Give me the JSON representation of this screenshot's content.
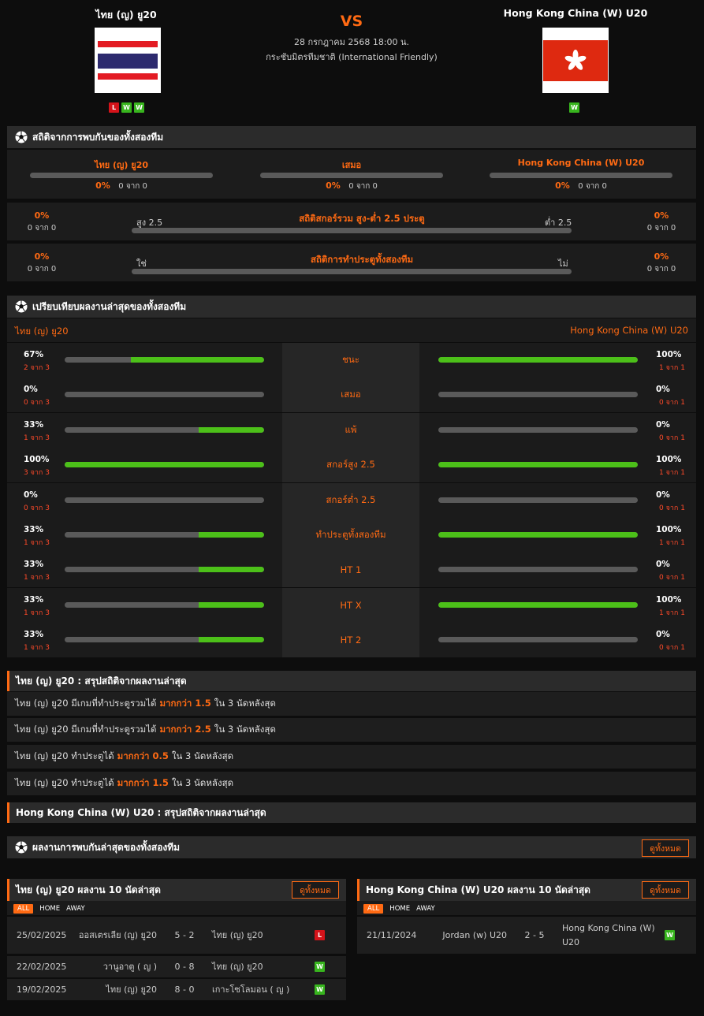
{
  "header": {
    "home_team": "ไทย (ญ) ยู20",
    "away_team": "Hong Kong China (W) U20",
    "vs": "VS",
    "datetime": "28 กรกฎาคม 2568 18:00 น.",
    "competition": "กระชับมิตรทีมชาติ (International Friendly)",
    "home_form": [
      "L",
      "W",
      "W"
    ],
    "away_form": [
      "W"
    ]
  },
  "h2h_stats": {
    "title": "สถิติจากการพบกันของทั้งสองทีม",
    "result": {
      "home_label": "ไทย (ญ) ยู20",
      "home_pct": "0%",
      "home_cnt": "0 จาก 0",
      "draw_label": "เสมอ",
      "draw_pct": "0%",
      "draw_cnt": "0 จาก 0",
      "away_label": "Hong Kong China (W) U20",
      "away_pct": "0%",
      "away_cnt": "0 จาก 0"
    },
    "ou": {
      "title": "สถิติสกอร์รวม สูง-ต่ำ 2.5 ประตู",
      "left_label": "สูง 2.5",
      "right_label": "ต่ำ 2.5",
      "left_pct": "0%",
      "left_cnt": "0 จาก 0",
      "right_pct": "0%",
      "right_cnt": "0 จาก 0"
    },
    "btts": {
      "title": "สถิติการทำประตูทั้งสองทีม",
      "left_label": "ใช่",
      "right_label": "ไม่",
      "left_pct": "0%",
      "left_cnt": "0 จาก 0",
      "right_pct": "0%",
      "right_cnt": "0 จาก 0"
    }
  },
  "compare": {
    "title": "เปรียบเทียบผลงานล่าสุดของทั้งสองทีม",
    "home_team": "ไทย (ญ) ยู20",
    "away_team": "Hong Kong China (W) U20",
    "rows": [
      {
        "label": "ชนะ",
        "home_pct": "67%",
        "home_cnt": "2 จาก 3",
        "home_fill": 0.67,
        "away_pct": "100%",
        "away_cnt": "1 จาก 1",
        "away_fill": 1.0
      },
      {
        "label": "เสมอ",
        "home_pct": "0%",
        "home_cnt": "0 จาก 3",
        "home_fill": 0,
        "away_pct": "0%",
        "away_cnt": "0 จาก 1",
        "away_fill": 0
      },
      {
        "label": "แพ้",
        "home_pct": "33%",
        "home_cnt": "1 จาก 3",
        "home_fill": 0.33,
        "away_pct": "0%",
        "away_cnt": "0 จาก 1",
        "away_fill": 0
      },
      {
        "label": "สกอร์สูง 2.5",
        "home_pct": "100%",
        "home_cnt": "3 จาก 3",
        "home_fill": 1.0,
        "away_pct": "100%",
        "away_cnt": "1 จาก 1",
        "away_fill": 1.0
      },
      {
        "label": "สกอร์ต่ำ 2.5",
        "home_pct": "0%",
        "home_cnt": "0 จาก 3",
        "home_fill": 0,
        "away_pct": "0%",
        "away_cnt": "0 จาก 1",
        "away_fill": 0
      },
      {
        "label": "ทำประตูทั้งสองทีม",
        "home_pct": "33%",
        "home_cnt": "1 จาก 3",
        "home_fill": 0.33,
        "away_pct": "100%",
        "away_cnt": "1 จาก 1",
        "away_fill": 1.0
      },
      {
        "label": "HT 1",
        "home_pct": "33%",
        "home_cnt": "1 จาก 3",
        "home_fill": 0.33,
        "away_pct": "0%",
        "away_cnt": "0 จาก 1",
        "away_fill": 0
      },
      {
        "label": "HT X",
        "home_pct": "33%",
        "home_cnt": "1 จาก 3",
        "home_fill": 0.33,
        "away_pct": "100%",
        "away_cnt": "1 จาก 1",
        "away_fill": 1.0
      },
      {
        "label": "HT 2",
        "home_pct": "33%",
        "home_cnt": "1 จาก 3",
        "home_fill": 0.33,
        "away_pct": "0%",
        "away_cnt": "0 จาก 1",
        "away_fill": 0
      }
    ]
  },
  "summary_home": {
    "title": "ไทย (ญ) ยู20 : สรุปสถิติจากผลงานล่าสุด",
    "rows": [
      {
        "pre": "ไทย (ญ) ยู20  มีเกมที่ทำประตูรวมได้",
        "hl": "มากกว่า  1.5",
        "post": "ใน 3 นัดหลังสุด"
      },
      {
        "pre": "ไทย (ญ) ยู20  มีเกมที่ทำประตูรวมได้",
        "hl": "มากกว่า  2.5",
        "post": "ใน 3 นัดหลังสุด"
      },
      {
        "pre": "ไทย (ญ) ยู20  ทำประตูได้",
        "hl": "มากกว่า  0.5",
        "post": "ใน 3 นัดหลังสุด"
      },
      {
        "pre": "ไทย (ญ) ยู20  ทำประตูได้",
        "hl": "มากกว่า  1.5",
        "post": "ใน 3 นัดหลังสุด"
      }
    ]
  },
  "summary_away": {
    "title": "Hong Kong China (W) U20 : สรุปสถิติจากผลงานล่าสุด"
  },
  "h2h_recent": {
    "title": "ผลงานการพบกันล่าสุดของทั้งสองทีม",
    "view_all": "ดูทั้งหมด"
  },
  "home_last10": {
    "title": "ไทย (ญ) ยู20 ผลงาน 10 นัดล่าสุด",
    "view_all": "ดูทั้งหมด",
    "tabs": [
      "ALL",
      "HOME",
      "AWAY"
    ],
    "matches": [
      {
        "date": "25/02/2025",
        "home": "ออสเตรเลีย (ญ) ยู20",
        "score": "5 - 2",
        "away": "ไทย (ญ) ยู20",
        "res": "L"
      },
      {
        "date": "22/02/2025",
        "home": "วานูอาตู ( ญ )",
        "score": "0 - 8",
        "away": "ไทย (ญ) ยู20",
        "res": "W"
      },
      {
        "date": "19/02/2025",
        "home": "ไทย (ญ) ยู20",
        "score": "8 - 0",
        "away": "เกาะโซโลมอน ( ญ )",
        "res": "W"
      }
    ]
  },
  "away_last10": {
    "title": "Hong Kong China (W) U20 ผลงาน 10 นัดล่าสุด",
    "view_all": "ดูทั้งหมด",
    "tabs": [
      "ALL",
      "HOME",
      "AWAY"
    ],
    "matches": [
      {
        "date": "21/11/2024",
        "home": "Jordan (w) U20",
        "score": "2 - 5",
        "away": "Hong Kong China (W) U20",
        "res": "W"
      }
    ]
  },
  "colors": {
    "accent": "#ff6a13",
    "win": "#38b51e",
    "loss": "#d4131a",
    "bar_fill": "#4cc019"
  }
}
